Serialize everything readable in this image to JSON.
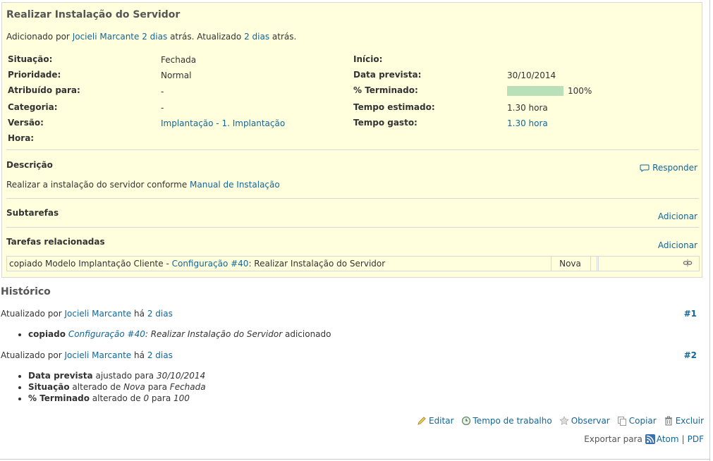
{
  "issue": {
    "title": "Realizar Instalação do Servidor",
    "author_prefix": "Adicionado por",
    "author": "Jocieli Marcante",
    "added_ago": "2 dias",
    "mid_text": "atrás. Atualizado",
    "updated_ago": "2 dias",
    "suffix": "atrás."
  },
  "attributes_left": [
    {
      "label": "Situação:",
      "value": "Fechada",
      "is_link": false
    },
    {
      "label": "Prioridade:",
      "value": "Normal",
      "is_link": false
    },
    {
      "label": "Atribuído para:",
      "value": "-",
      "is_link": false
    },
    {
      "label": "Categoria:",
      "value": "-",
      "is_link": false
    },
    {
      "label": "Versão:",
      "value": "Implantação - 1. Implantação",
      "is_link": true
    },
    {
      "label": "Hora:",
      "value": "",
      "is_link": false
    }
  ],
  "attributes_right": [
    {
      "label": "Início:",
      "value": ""
    },
    {
      "label": "Data prevista:",
      "value": "30/10/2014"
    },
    {
      "label": "% Terminado:",
      "value": "100%",
      "progress": 1.0
    },
    {
      "label": "Tempo estimado:",
      "value": "1.30 hora"
    },
    {
      "label": "Tempo gasto:",
      "value": "1.30 hora"
    }
  ],
  "description": {
    "title": "Descrição",
    "reply": "Responder",
    "text_prefix": "Realizar a instalação do servidor conforme",
    "link": "Manual de Instalação"
  },
  "subtasks": {
    "title": "Subtarefas",
    "add": "Adicionar"
  },
  "relations": {
    "title": "Tarefas relacionadas",
    "add": "Adicionar",
    "row": {
      "prefix": "copiado Modelo Implantação Cliente -",
      "link": "Configuração #40",
      "subject": ": Realizar Instalação do Servidor",
      "status": "Nova"
    }
  },
  "history": {
    "title": "Histórico",
    "journals": [
      {
        "prefix": "Atualizado por",
        "author": "Jocieli Marcante",
        "mid": "há",
        "ago": "2 dias",
        "number": "#1",
        "details": [
          {
            "bold": "copiado",
            "link": "Configuração #40",
            "italic": ": Realizar Instalação do Servidor",
            "tail": "adicionado"
          }
        ]
      },
      {
        "prefix": "Atualizado por",
        "author": "Jocieli Marcante",
        "mid": "há",
        "ago": "2 dias",
        "number": "#2",
        "details": [
          {
            "bold": "Data prevista",
            "text1": "ajustado para",
            "val1": "30/10/2014"
          },
          {
            "bold": "Situação",
            "text1": "alterado de",
            "val1": "Nova",
            "text2": "para",
            "val2": "Fechada"
          },
          {
            "bold": "% Terminado",
            "text1": "alterado de",
            "val1": "0",
            "text2": "para",
            "val2": "100"
          }
        ]
      }
    ]
  },
  "actions": {
    "edit": "Editar",
    "time": "Tempo de trabalho",
    "watch": "Observar",
    "copy": "Copiar",
    "delete": "Excluir"
  },
  "export": {
    "label": "Exportar para",
    "atom": "Atom",
    "sep": "|",
    "pdf": "PDF"
  },
  "colors": {
    "issue_bg": "#ffffdd",
    "link": "#169",
    "progress": "#bae0ba"
  }
}
